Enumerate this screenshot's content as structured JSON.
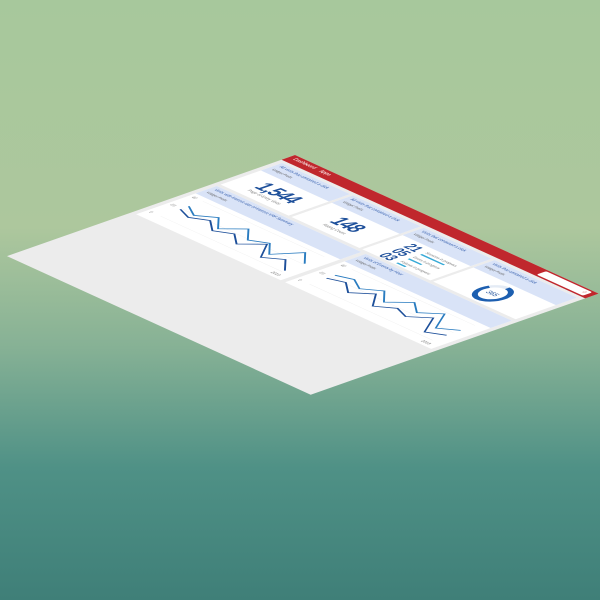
{
  "topbar": {
    "nav": [
      "Dashboard",
      "Apps"
    ],
    "search_icon": "search-icon"
  },
  "cards": {
    "metric1": {
      "title": "All visits that contained a click",
      "sub": "Widget Prefix",
      "value": "1,544",
      "caption": "Page of Entry Visits"
    },
    "metric2": {
      "title": "All visits that contained a click",
      "sub": "Widget Prefix",
      "value": "148",
      "caption": "Rating Count"
    },
    "metric3": {
      "title": "Visits that contained a click",
      "sub": "Widget Prefix",
      "rows": [
        {
          "value": "21",
          "label": "Sessions in progress",
          "fill": 0.8
        },
        {
          "value": "05",
          "label": "Errors in progress",
          "fill": 0.45
        },
        {
          "value": "03",
          "label": "Failures in progress",
          "fill": 0.3
        }
      ]
    },
    "donut": {
      "title": "Visits that contained a click",
      "sub": "Widget Prefix",
      "value": "365",
      "fill": 0.82
    },
    "chart1": {
      "title": "Visits with interest rate of interest VRF Summary",
      "sub": "Widget Prefix",
      "x_end": "2018",
      "y_ticks": [
        "40",
        "20",
        "0"
      ]
    },
    "chart2": {
      "title": "Visits of Events by Hour",
      "sub": "Widget Prefix",
      "x_end": "2018",
      "y_ticks": [
        "40",
        "20",
        "0"
      ]
    }
  },
  "chart_data": [
    {
      "type": "line",
      "series": [
        {
          "values": [
            20,
            14,
            22,
            12,
            24,
            14,
            20,
            10,
            26,
            16
          ]
        },
        {
          "values": [
            14,
            10,
            16,
            8,
            14,
            6,
            18,
            4,
            12,
            2
          ]
        }
      ]
    },
    {
      "type": "line",
      "series": [
        {
          "values": [
            18,
            22,
            16,
            24,
            14,
            26,
            18,
            28,
            12,
            20
          ]
        },
        {
          "values": [
            12,
            16,
            8,
            18,
            6,
            14,
            10,
            20,
            4,
            10
          ]
        }
      ]
    }
  ],
  "colors": {
    "brand": "#c0272d",
    "accent": "#1d4f9a",
    "line": "#1d6fb0",
    "head": "#d9e3f7"
  }
}
